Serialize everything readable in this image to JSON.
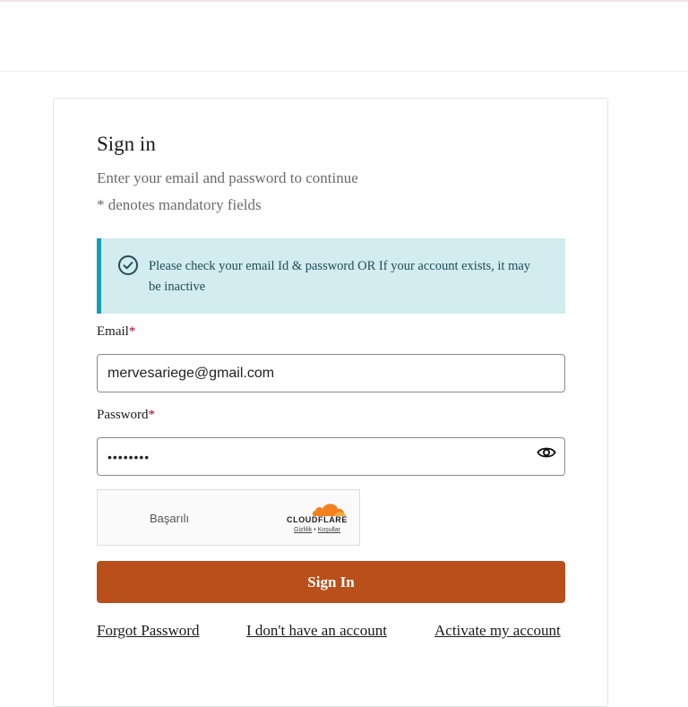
{
  "signin": {
    "title": "Sign in",
    "subtitle": "Enter your email and password to continue",
    "mandatory_note": "* denotes mandatory fields"
  },
  "alert": {
    "message": "Please check your email Id & password OR If your account exists, it may be inactive",
    "icon": "check-circle-icon",
    "color": "#d3ecef",
    "accent": "#14a0b0"
  },
  "form": {
    "email_label": "Email",
    "email_value": "mervesariege@gmail.com",
    "password_label": "Password",
    "password_value": "••••••••",
    "required_marker": "*"
  },
  "captcha": {
    "status": "Başarılı",
    "brand": "CLOUDFLARE",
    "privacy_link": "Gizlilik",
    "separator": "•",
    "terms_link": "Koşullar"
  },
  "actions": {
    "sign_in_label": "Sign In",
    "sign_in_color": "#b94f1b",
    "forgot_password": "Forgot Password",
    "no_account": "I don't have an account",
    "activate_account": "Activate my account"
  }
}
